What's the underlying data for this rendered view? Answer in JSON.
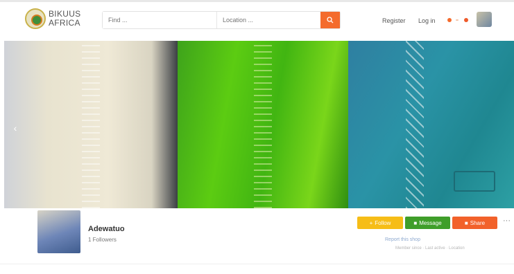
{
  "brand": {
    "name": "BIKUUS AFRICA",
    "line1": "BIKUUS",
    "line2": "AFRICA"
  },
  "search": {
    "placeholder": "Find ...",
    "location_placeholder": "Location ..."
  },
  "nav": {
    "register": "Register",
    "login": "Log in"
  },
  "shop": {
    "name": "Adewatuo",
    "subtitle": "1 Followers"
  },
  "actions": {
    "follow": "Follow",
    "message": "Message",
    "share": "Share",
    "more": "···"
  },
  "profile_link": "Report this shop",
  "profile_meta": "Member since · Last active · Location",
  "colors": {
    "accent": "#f46b2c",
    "yellow": "#f6bd17",
    "green": "#3f9e2a"
  }
}
